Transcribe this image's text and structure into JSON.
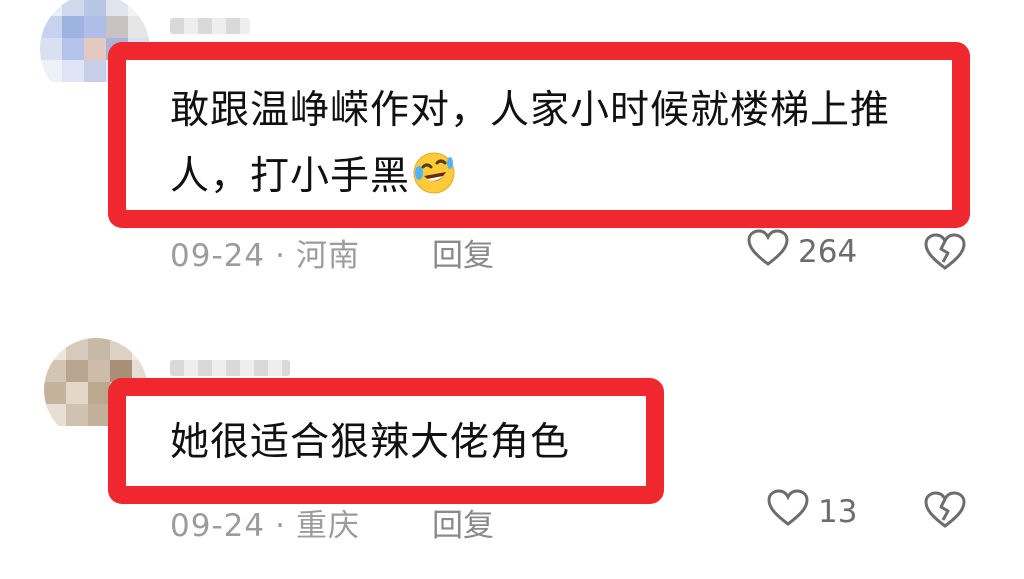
{
  "comments": [
    {
      "text_line1": "敢跟温峥嵘作对，人家小时候就楼梯上推",
      "text_line2": "人，打小手黑",
      "emoji": "rolling-laughing-emoji",
      "date": "09-24",
      "location": "河南",
      "reply_label": "回复",
      "likes": "264"
    },
    {
      "text_line1": "她很适合狠辣大佬角色",
      "date": "09-24",
      "location": "重庆",
      "reply_label": "回复",
      "likes": "13"
    }
  ],
  "colors": {
    "highlight": "#f0272e",
    "meta_text": "#9c9c9c"
  },
  "icons": [
    "heart-outline-icon",
    "broken-heart-icon"
  ]
}
